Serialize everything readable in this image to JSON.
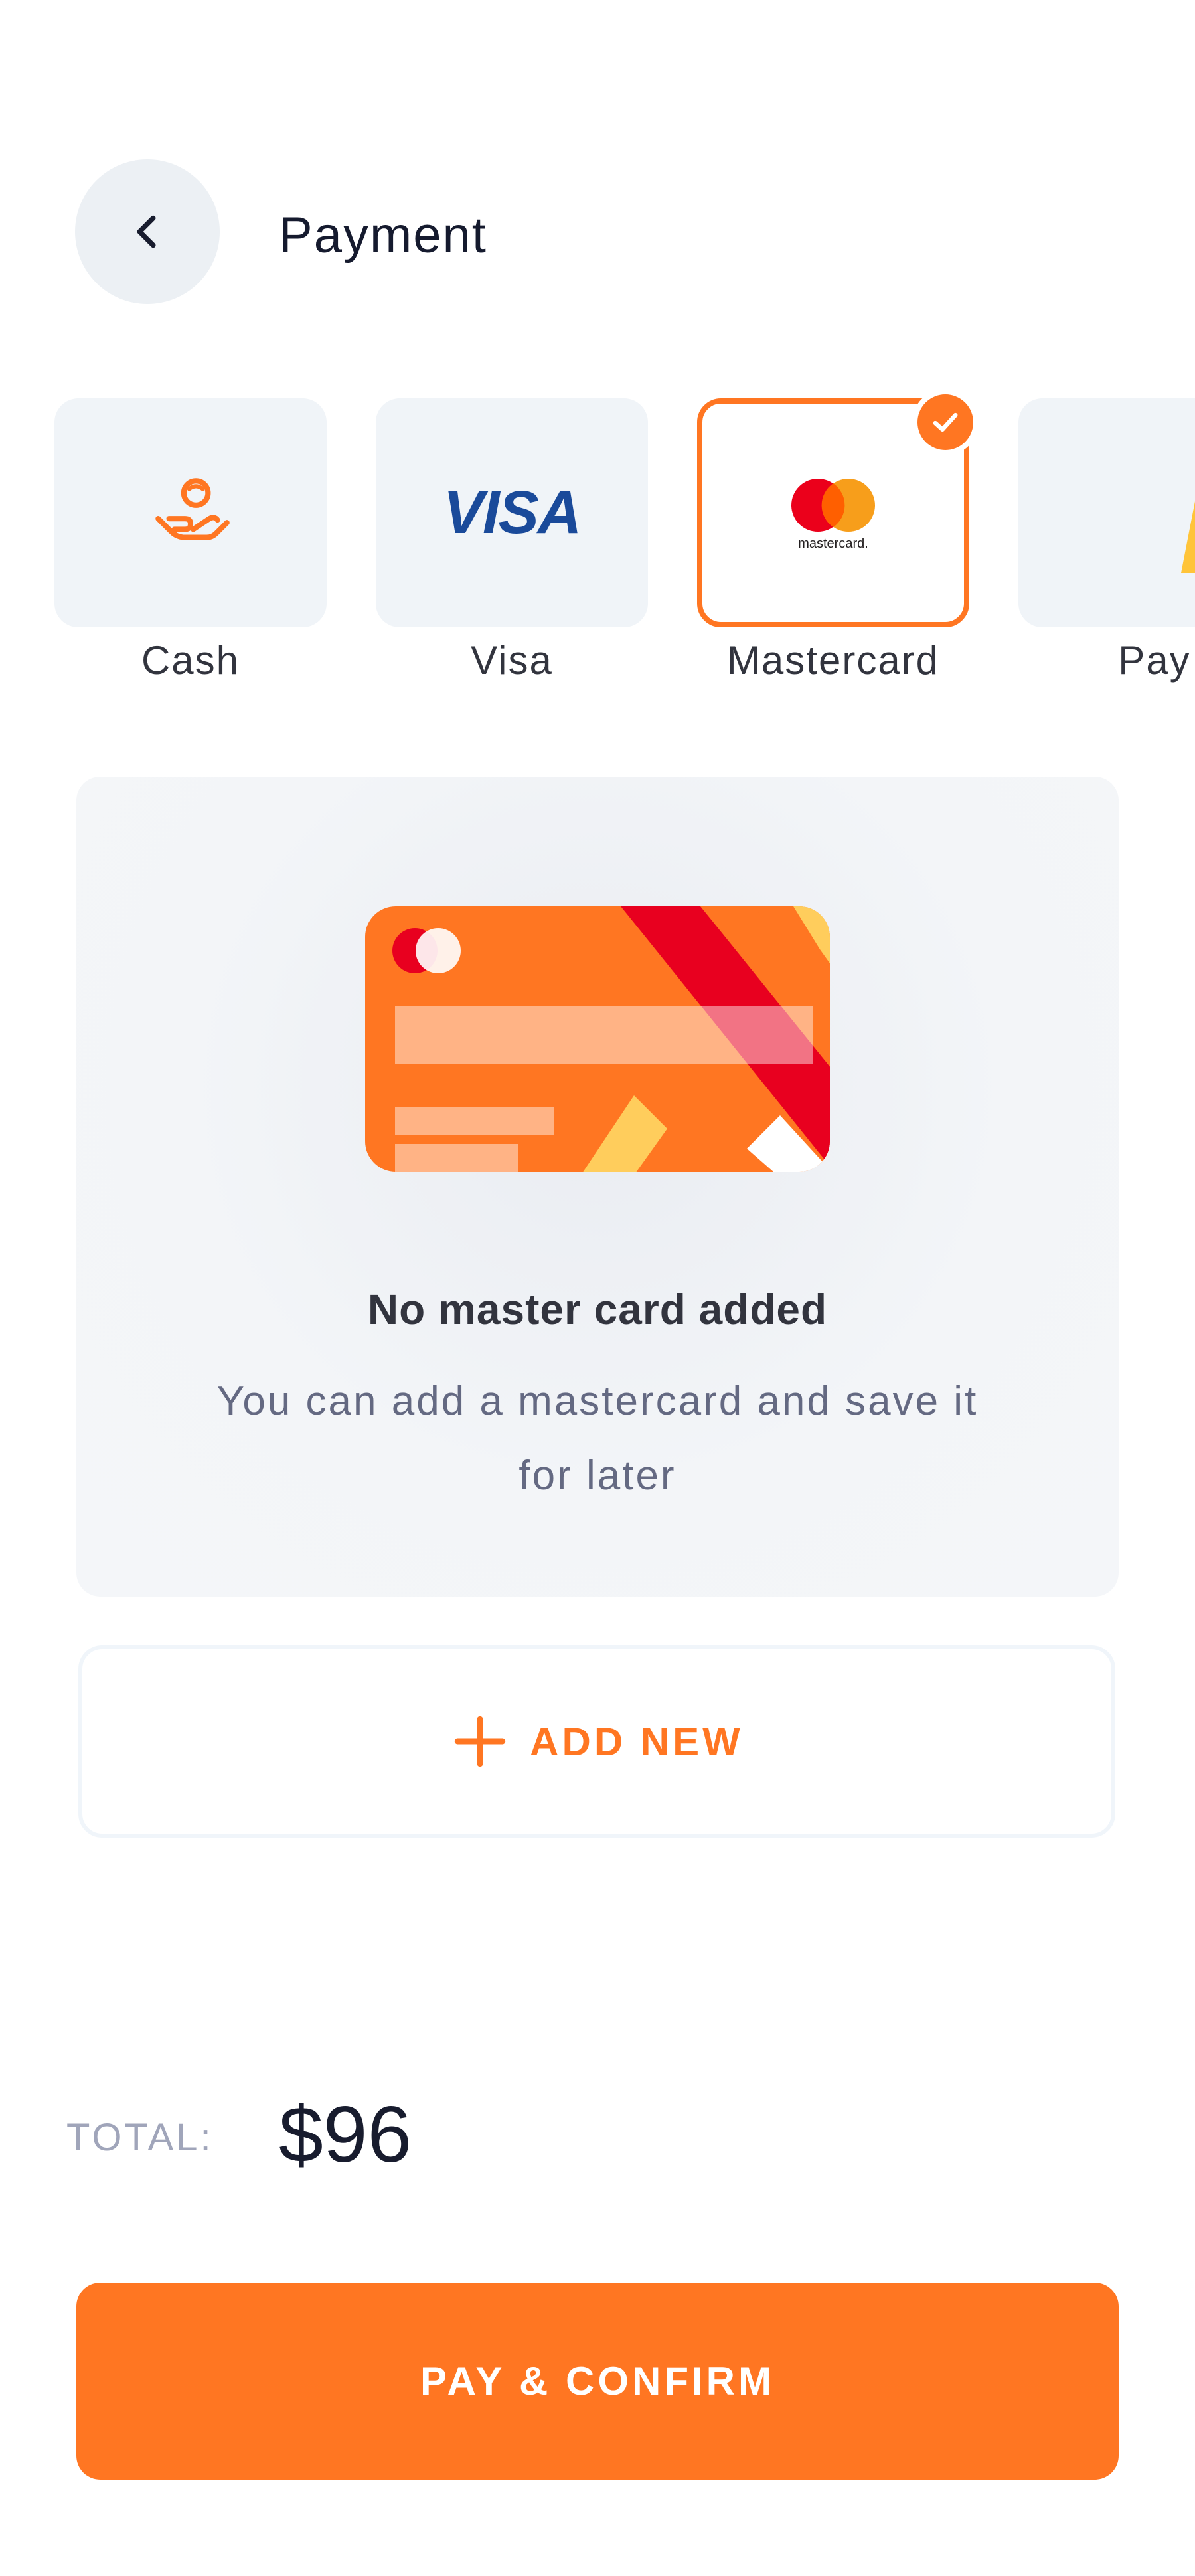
{
  "header": {
    "title": "Payment",
    "back_icon": "chevron-left-icon"
  },
  "methods": [
    {
      "label": "Cash",
      "icon": "hand-coin-icon",
      "selected": false
    },
    {
      "label": "Visa",
      "logo_text": "VISA",
      "selected": false
    },
    {
      "label": "Mastercard",
      "logo_text": "mastercard.",
      "selected": true
    },
    {
      "label": "Pay",
      "icon": "paypal-logo",
      "selected": false
    }
  ],
  "empty_state": {
    "title": "No master card added",
    "description": "You can add a mastercard and save it for later"
  },
  "add_new": {
    "label": "ADD NEW",
    "icon": "plus-icon"
  },
  "total": {
    "label": "TOTAL:",
    "value": "$96"
  },
  "pay_button": {
    "label": "PAY & CONFIRM"
  },
  "colors": {
    "accent": "#ff7622",
    "tile_bg": "#f0f4f8",
    "text_dark": "#181c2e",
    "text_muted": "#a0a5ba"
  }
}
